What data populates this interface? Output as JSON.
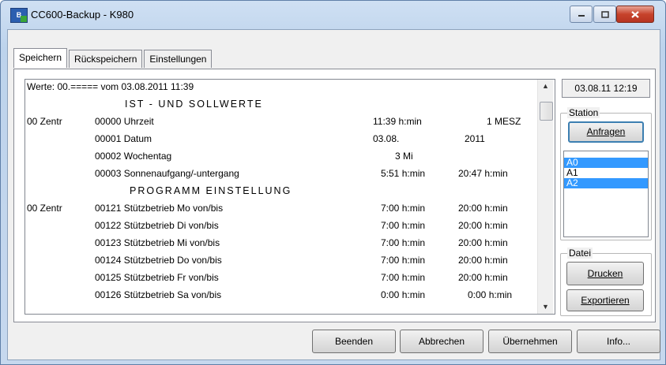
{
  "window": {
    "title": "CC600-Backup - K980",
    "icon_text": "B"
  },
  "tabs": [
    "Speichern",
    "Rückspeichern",
    "Einstellungen"
  ],
  "timestamp": "03.08.11 12:19",
  "station": {
    "label": "Station",
    "anfragen": "Anfragen",
    "items": [
      {
        "label": "A0",
        "selected": true
      },
      {
        "label": "A1",
        "selected": false
      },
      {
        "label": "A2",
        "selected": true
      }
    ]
  },
  "datei": {
    "label": "Datei",
    "drucken": "Drucken",
    "exportieren": "Exportieren"
  },
  "footer": {
    "beenden": "Beenden",
    "abbrechen": "Abbrechen",
    "uebernehmen": "Übernehmen",
    "info": "Info..."
  },
  "list": {
    "header": "Werte: 00.===== vom  03.08.2011 11:39",
    "section1": "IST - UND  SOLLWERTE",
    "section2": "PROGRAMM EINSTELLUNG",
    "rows1": [
      {
        "c0": "00 Zentr",
        "c1": "00000 Uhrzeit",
        "c2": "11:39 h:min",
        "c3": "1 MESZ"
      },
      {
        "c0": "",
        "c1": "00001 Datum",
        "c2": "03.08.",
        "c3": "2011"
      },
      {
        "c0": "",
        "c1": "00002 Wochentag",
        "c2": "3 Mi",
        "c3": ""
      },
      {
        "c0": "",
        "c1": "00003 Sonnenaufgang/-untergang",
        "c2": "5:51 h:min",
        "c3": "20:47 h:min"
      }
    ],
    "rows2": [
      {
        "c0": "00 Zentr",
        "c1": "00121 Stützbetrieb Mo von/bis",
        "c2": "7:00 h:min",
        "c3": "20:00 h:min"
      },
      {
        "c0": "",
        "c1": "00122 Stützbetrieb Di von/bis",
        "c2": "7:00 h:min",
        "c3": "20:00 h:min"
      },
      {
        "c0": "",
        "c1": "00123 Stützbetrieb Mi von/bis",
        "c2": "7:00 h:min",
        "c3": "20:00 h:min"
      },
      {
        "c0": "",
        "c1": "00124 Stützbetrieb Do von/bis",
        "c2": "7:00 h:min",
        "c3": "20:00 h:min"
      },
      {
        "c0": "",
        "c1": "00125 Stützbetrieb Fr von/bis",
        "c2": "7:00 h:min",
        "c3": "20:00 h:min"
      },
      {
        "c0": "",
        "c1": "00126 Stützbetrieb Sa von/bis",
        "c2": "0:00 h:min",
        "c3": "0:00 h:min"
      }
    ]
  }
}
